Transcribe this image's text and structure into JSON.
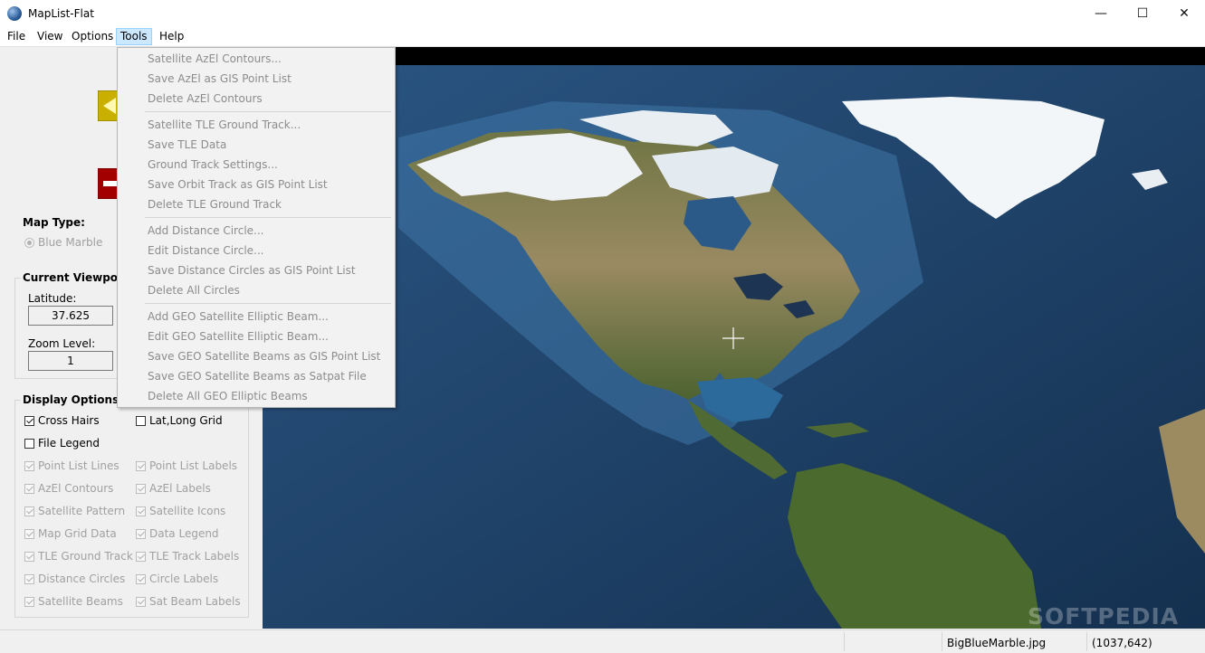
{
  "window": {
    "title": "MapList-Flat",
    "controls": {
      "minimize": "—",
      "maximize": "☐",
      "close": "✕"
    }
  },
  "menubar": {
    "items": [
      "File",
      "View",
      "Options",
      "Tools",
      "Help"
    ]
  },
  "tools_menu": {
    "items": [
      "Satellite AzEl Contours...",
      "Save AzEl as GIS Point List",
      "Delete AzEl Contours",
      "Satellite TLE Ground Track...",
      "Save TLE Data",
      "Ground Track Settings...",
      "Save Orbit Track as GIS Point List",
      "Delete TLE Ground Track",
      "Add Distance Circle...",
      "Edit Distance Circle...",
      "Save Distance Circles as GIS Point List",
      "Delete All Circles",
      "Add GEO Satellite Elliptic Beam...",
      "Edit GEO Satellite Elliptic Beam...",
      "Save GEO Satellite Beams as GIS Point List",
      "Save GEO Satellite Beams as Satpat File",
      "Delete All GEO Elliptic Beams"
    ]
  },
  "map_type": {
    "title": "Map Type:",
    "selected": "Blue Marble"
  },
  "viewpoint": {
    "title": "Current Viewpoint",
    "latitude_label": "Latitude:",
    "latitude_value": "37.625",
    "zoom_label": "Zoom Level:",
    "zoom_value": "1"
  },
  "display_options": {
    "title": "Display Options:",
    "items": [
      {
        "label": "Cross Hairs",
        "checked": true,
        "enabled": true
      },
      {
        "label": "Lat,Long Grid",
        "checked": false,
        "enabled": true
      },
      {
        "label": "File Legend",
        "checked": false,
        "enabled": true
      },
      {
        "label": "Point List Lines",
        "checked": true,
        "enabled": false
      },
      {
        "label": "Point List Labels",
        "checked": true,
        "enabled": false
      },
      {
        "label": "AzEl Contours",
        "checked": true,
        "enabled": false
      },
      {
        "label": "AzEl Labels",
        "checked": true,
        "enabled": false
      },
      {
        "label": "Satellite Pattern",
        "checked": true,
        "enabled": false
      },
      {
        "label": "Satellite Icons",
        "checked": true,
        "enabled": false
      },
      {
        "label": "Map Grid Data",
        "checked": true,
        "enabled": false
      },
      {
        "label": "Data Legend",
        "checked": true,
        "enabled": false
      },
      {
        "label": "TLE Ground Track",
        "checked": true,
        "enabled": false
      },
      {
        "label": "TLE Track Labels",
        "checked": true,
        "enabled": false
      },
      {
        "label": "Distance Circles",
        "checked": true,
        "enabled": false
      },
      {
        "label": "Circle Labels",
        "checked": true,
        "enabled": false
      },
      {
        "label": "Satellite Beams",
        "checked": true,
        "enabled": false
      },
      {
        "label": "Sat Beam Labels",
        "checked": true,
        "enabled": false
      }
    ]
  },
  "statusbar": {
    "file": "BigBlueMarble.jpg",
    "coords": "(1037,642)"
  },
  "watermark": "SOFTPEDIA",
  "colors": {
    "menu_highlight": "#cce8ff",
    "ocean": "#1b3e66",
    "land": "#7a7a52",
    "ice": "#f2f5f7"
  }
}
